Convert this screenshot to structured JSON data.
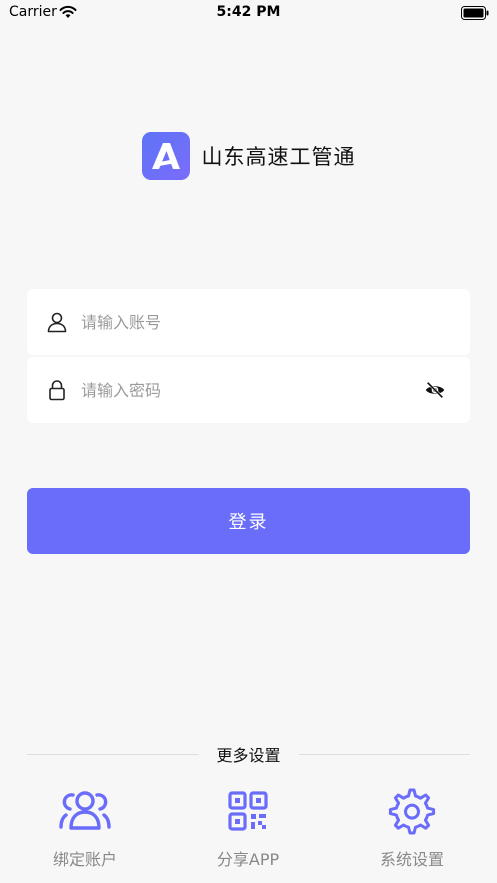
{
  "status_bar": {
    "carrier": "Carrier",
    "time": "5:42 PM"
  },
  "brand": {
    "app_name": "山东高速工管通",
    "logo_color": "#6a6cfa"
  },
  "login_form": {
    "account_placeholder": "请输入账号",
    "password_placeholder": "请输入密码",
    "login_label": "登录"
  },
  "more_settings": {
    "title": "更多设置",
    "items": [
      {
        "label": "绑定账户",
        "icon": "users-icon"
      },
      {
        "label": "分享APP",
        "icon": "qr-code-icon"
      },
      {
        "label": "系统设置",
        "icon": "gear-icon"
      }
    ]
  },
  "colors": {
    "accent": "#6a6cfa",
    "background": "#f7f7f7"
  }
}
